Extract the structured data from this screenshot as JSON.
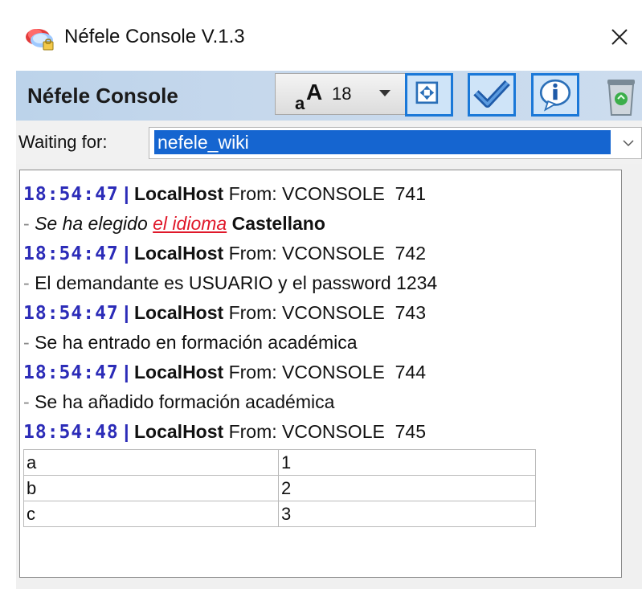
{
  "window": {
    "title": "Néfele Console V.1.3",
    "close_symbol": "✕"
  },
  "header": {
    "title": "Néfele Console",
    "font_size": "18"
  },
  "toolbar": {
    "icons": [
      "font-size-icon",
      "fit-window-icon",
      "checkmark-icon",
      "info-icon",
      "recycle-bin-icon"
    ]
  },
  "waiting": {
    "label": "Waiting for:",
    "value": "nefele_wiki"
  },
  "log": [
    {
      "time": "18:54:47",
      "sep": "|",
      "host": "LocalHost",
      "from": "From: VCONSOLE",
      "id": "741"
    },
    {
      "dash": "-",
      "text_before": "Se ha elegido",
      "link": "el idioma",
      "bold": "Castellano"
    },
    {
      "time": "18:54:47",
      "sep": "|",
      "host": "LocalHost",
      "from": "From: VCONSOLE",
      "id": "742"
    },
    {
      "dash": "-",
      "text": "El demandante es USUARIO y el password 1234"
    },
    {
      "time": "18:54:47",
      "sep": "|",
      "host": "LocalHost",
      "from": "From: VCONSOLE",
      "id": "743"
    },
    {
      "dash": "-",
      "text": "Se ha entrado en formación académica"
    },
    {
      "time": "18:54:47",
      "sep": "|",
      "host": "LocalHost",
      "from": "From: VCONSOLE",
      "id": "744"
    },
    {
      "dash": "-",
      "text": "Se ha añadido formación académica"
    },
    {
      "time": "18:54:48",
      "sep": "|",
      "host": "LocalHost",
      "from": "From: VCONSOLE",
      "id": "745"
    }
  ],
  "table": {
    "rows": [
      [
        "a",
        "1"
      ],
      [
        "b",
        "2"
      ],
      [
        "c",
        "3"
      ]
    ]
  },
  "colors": {
    "header_bg": "#c6d8ec",
    "selection": "#1565d0",
    "timestamp": "#2c2cb8",
    "link": "#e0182a",
    "button_border": "#1a78d8"
  }
}
